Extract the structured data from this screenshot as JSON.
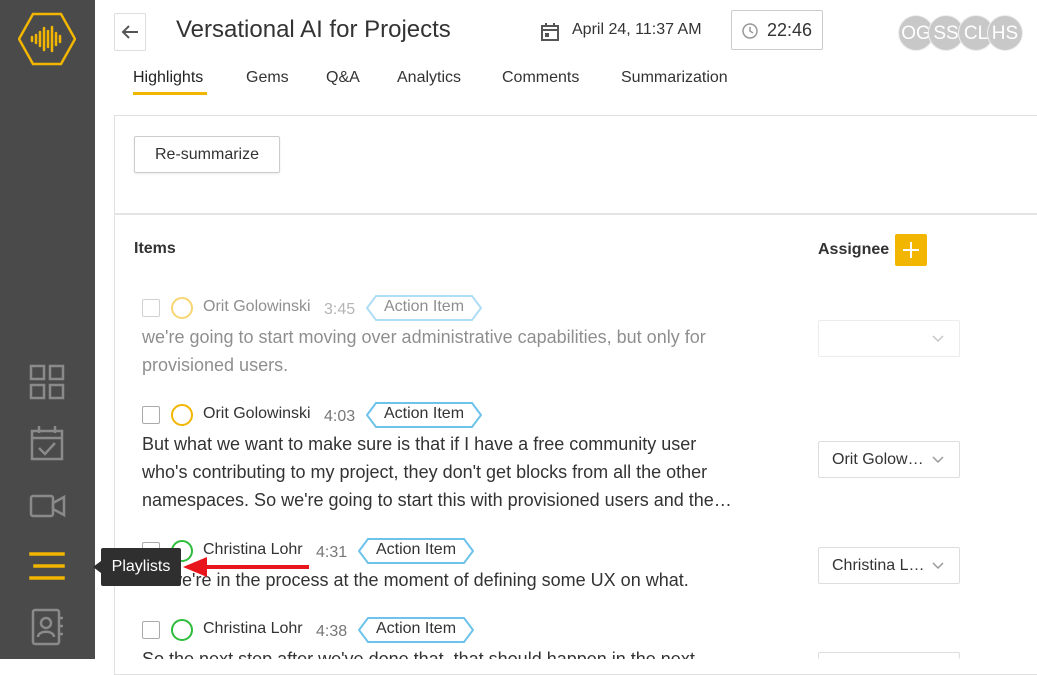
{
  "app": {
    "logo_icon": "soundwave-hexagon-icon",
    "brand_color": "#f2b500"
  },
  "sidebar": {
    "items": [
      {
        "icon": "dashboard-grid-icon"
      },
      {
        "icon": "calendar-check-icon"
      },
      {
        "icon": "video-camera-icon"
      },
      {
        "icon": "playlists-menu-icon",
        "active": true
      },
      {
        "icon": "contacts-book-icon"
      }
    ],
    "tooltip": "Playlists"
  },
  "header": {
    "title": "Versational AI for Projects",
    "date": "April 24, 11:37 AM",
    "duration": "22:46",
    "avatars": [
      "OG",
      "SS",
      "CL",
      "HS"
    ]
  },
  "tabs": [
    {
      "label": "Highlights",
      "active": true
    },
    {
      "label": "Gems"
    },
    {
      "label": "Q&A"
    },
    {
      "label": "Analytics"
    },
    {
      "label": "Comments"
    },
    {
      "label": "Summarization"
    }
  ],
  "toolbar": {
    "resummarize_label": "Re-summarize"
  },
  "list": {
    "items_header": "Items",
    "assignee_header": "Assignee",
    "rows": [
      {
        "speaker": "Orit Golowinski",
        "time": "3:45",
        "tag": "Action Item",
        "text": "we're going to start moving over administrative capabilities, but only for provisioned users.",
        "assignee": "",
        "circle_color": "#f2b500",
        "dimmed": true
      },
      {
        "speaker": "Orit Golowinski",
        "time": "4:03",
        "tag": "Action Item",
        "text": "But what we want to make sure is that if I have a free community user who's contributing to my project, they don't get blocks from all the other namespaces. So we're going to start this with provisioned users and the…",
        "assignee": "Orit Golow…",
        "circle_color": "#f2b500",
        "dimmed": false
      },
      {
        "speaker": "Christina Lohr",
        "time": "4:31",
        "tag": "Action Item",
        "text": "So we're in the process at the moment of defining some UX on what.",
        "assignee": "Christina L…",
        "circle_color": "#2ebd3c",
        "dimmed": false
      },
      {
        "speaker": "Christina Lohr",
        "time": "4:38",
        "tag": "Action Item",
        "text": "So the next step after we've done that, that should happen in the next",
        "assignee": "",
        "circle_color": "#2ebd3c",
        "dimmed": false
      }
    ]
  },
  "colors": {
    "tag_outline": "#6ec3ea",
    "annotation_arrow": "#e8161c"
  }
}
